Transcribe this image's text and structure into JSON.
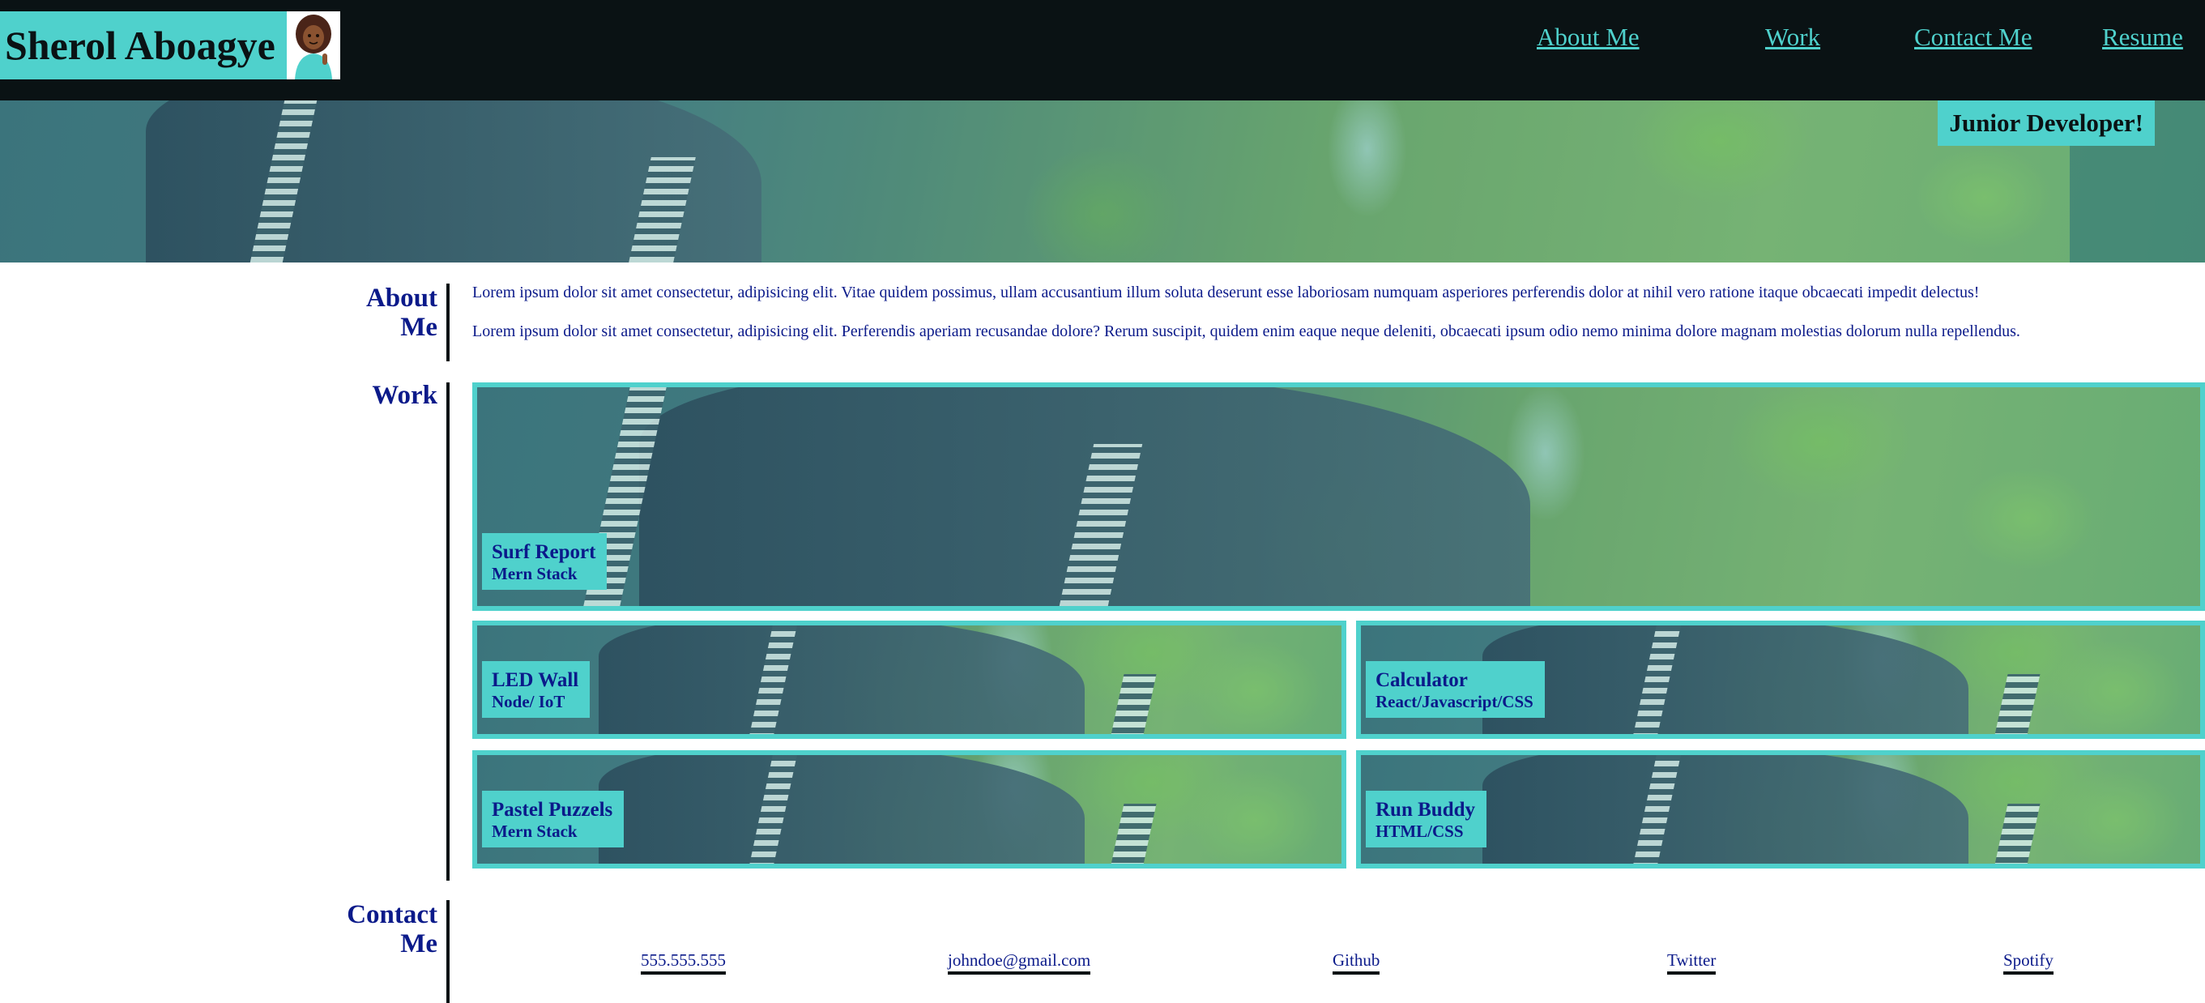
{
  "header": {
    "brand_name": "Sherol Aboagye",
    "nav": [
      "About Me",
      "Work",
      "Contact Me",
      "Resume"
    ]
  },
  "hero": {
    "tagline": "Junior Developer!"
  },
  "about": {
    "title": "About Me",
    "paragraphs": [
      "Lorem ipsum dolor sit amet consectetur, adipisicing elit. Vitae quidem possimus, ullam accusantium illum soluta deserunt esse laboriosam numquam asperiores perferendis dolor at nihil vero ratione itaque obcaecati impedit delectus!",
      "Lorem ipsum dolor sit amet consectetur, adipisicing elit. Perferendis aperiam recusandae dolore? Rerum suscipit, quidem enim eaque neque deleniti, obcaecati ipsum odio nemo minima dolore magnam molestias dolorum nulla repellendus."
    ]
  },
  "work": {
    "title": "Work",
    "projects": [
      {
        "title": "Surf Report",
        "stack": "Mern Stack"
      },
      {
        "title": "LED Wall",
        "stack": "Node/ IoT"
      },
      {
        "title": "Calculator",
        "stack": "React/Javascript/CSS"
      },
      {
        "title": "Pastel Puzzels",
        "stack": "Mern Stack"
      },
      {
        "title": "Run Buddy",
        "stack": "HTML/CSS"
      }
    ]
  },
  "contact": {
    "title": "Contact Me",
    "links": [
      "555.555.555",
      "johndoe@gmail.com",
      "Github",
      "Twitter",
      "Spotify"
    ]
  },
  "colors": {
    "accent": "#4fd1cc",
    "header_bg": "#0a1214",
    "text": "#0b1a8a"
  }
}
